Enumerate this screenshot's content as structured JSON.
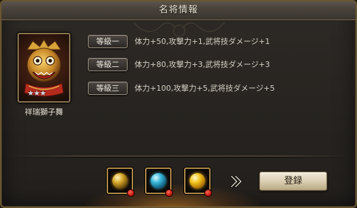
{
  "dialog": {
    "title": "名将情報"
  },
  "hero": {
    "name": "祥瑞獅子舞",
    "stars": "★★★",
    "star_count": 3
  },
  "levels": [
    {
      "label": "等級一",
      "bonus": "体力+50,攻撃力+1,武将技ダメージ+1"
    },
    {
      "label": "等級二",
      "bonus": "体力+80,攻撃力+3,武将技ダメージ+3"
    },
    {
      "label": "等級三",
      "bonus": "体力+100,攻撃力+5,武将技ダメージ+5"
    }
  ],
  "materials": [
    {
      "icon": "gold-orb-icon"
    },
    {
      "icon": "blue-orb-icon"
    },
    {
      "icon": "yellow-orb-icon"
    }
  ],
  "actions": {
    "register_label": "登録",
    "arrow_icon": "double-chevron-right-icon"
  },
  "colors": {
    "border": "#6b5630",
    "glow": "#f0962a"
  }
}
